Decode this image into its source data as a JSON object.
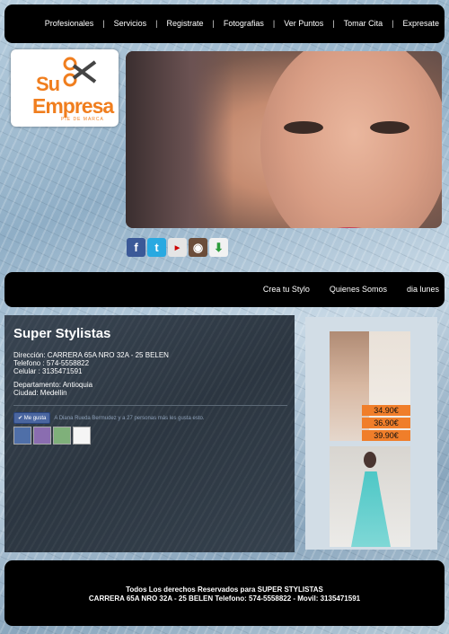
{
  "nav": {
    "items": [
      "Profesionales",
      "Servicios",
      "Registrate",
      "Fotografias",
      "Ver Puntos",
      "Tomar Cita",
      "Expresate"
    ],
    "separator": "|"
  },
  "logo": {
    "line1": "Su",
    "line2": "Empresa",
    "tagline": "PIE DE MARCA"
  },
  "social": {
    "icons": [
      "facebook-icon",
      "twitter-icon",
      "youtube-icon",
      "instagram-icon",
      "download-icon"
    ]
  },
  "subnav": {
    "items": [
      "Crea tu Stylo",
      "Quienes Somos",
      "dia lunes"
    ]
  },
  "main": {
    "title": "Super Stylistas",
    "address": "Dirección: CARRERA 65A NRO 32A - 25 BELEN",
    "phone": "Telefono : 574-5558822",
    "cell": "Celular : 3135471591",
    "department": "Departamento: Antioquia",
    "city": "Ciudad: Medellin",
    "like_button": "Me gusta",
    "like_text": "A Diana Rueda Bermudez y a 27 personas más les gusta esto."
  },
  "sidebar": {
    "prices": [
      "34.90€",
      "36.90€",
      "39.90€"
    ]
  },
  "footer": {
    "line1": "Todos Los derechos Reservados para SUPER STYLISTAS",
    "line2": "CARRERA 65A NRO 32A - 25 BELEN Telefono: 574-5558822 - Movil: 3135471591"
  },
  "colors": {
    "accent": "#f07e1e",
    "bar": "#000000",
    "panel": "#323d48"
  }
}
